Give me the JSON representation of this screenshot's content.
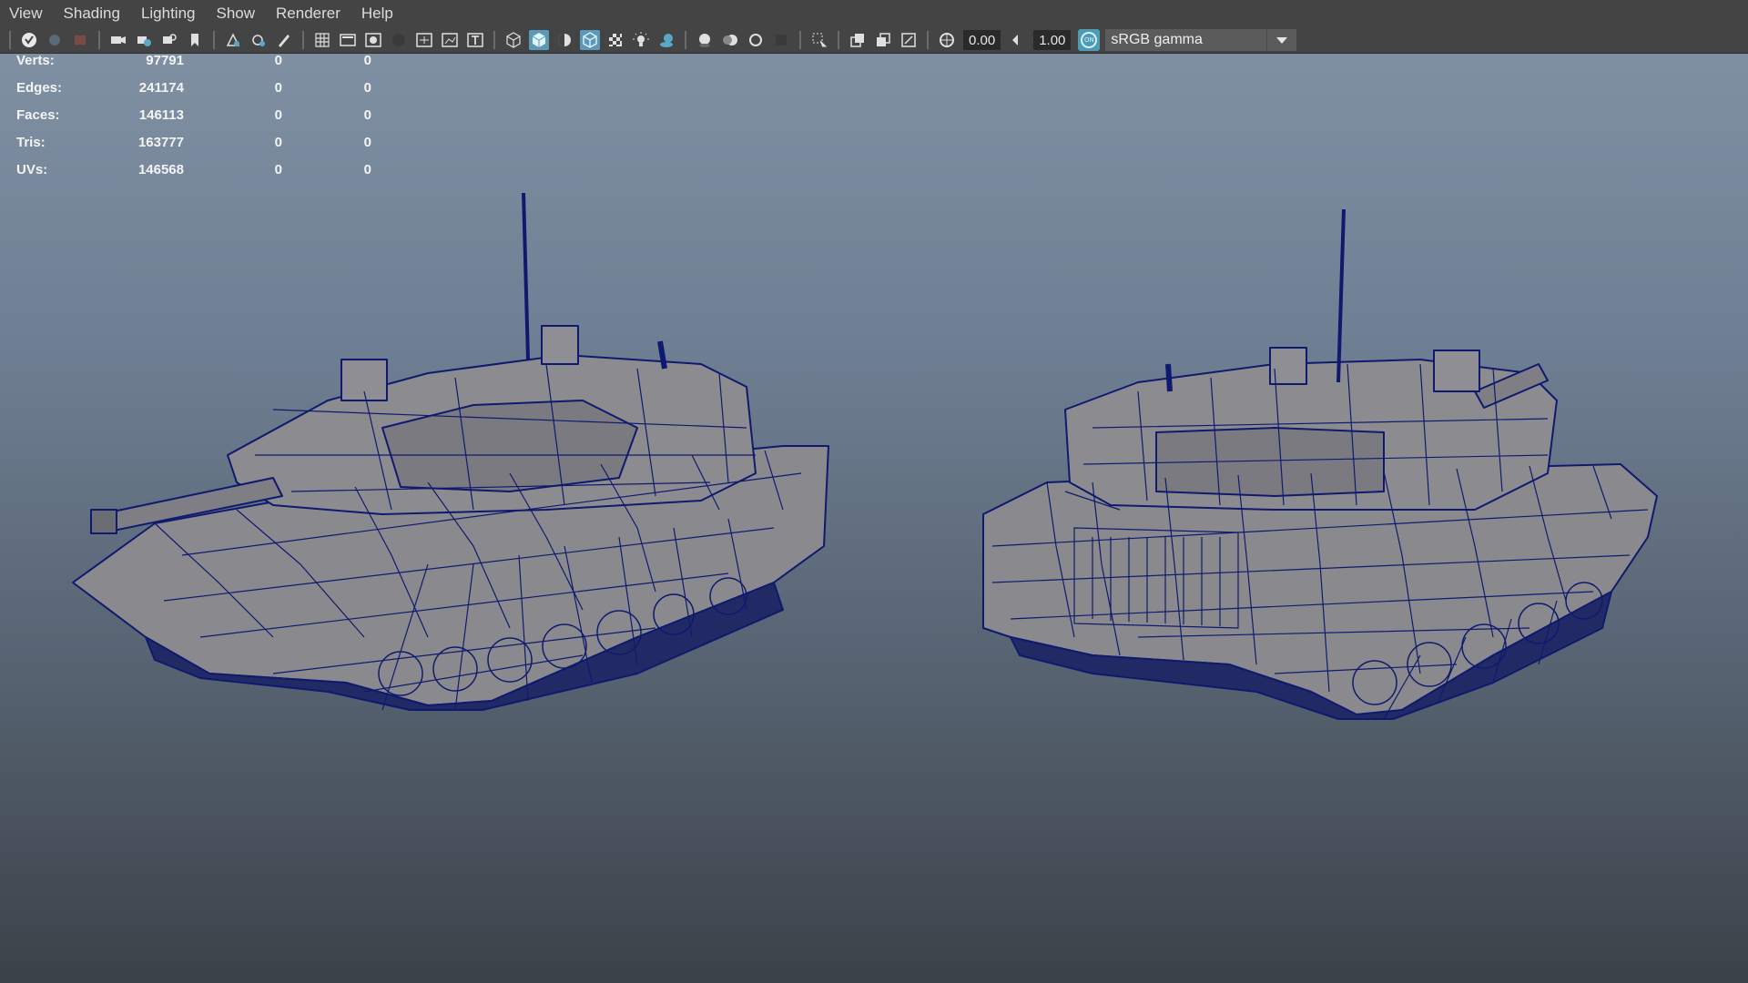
{
  "menu": [
    "View",
    "Shading",
    "Lighting",
    "Show",
    "Renderer",
    "Help"
  ],
  "toolbar": {
    "exposure": "0.00",
    "gamma": "1.00",
    "color_management_icon": "on-toggle-icon",
    "view_transform": "sRGB gamma",
    "icons": [
      "select-camera-icon",
      "camera-icon",
      "camera-attributes-icon",
      "bookmark-icon",
      "image-plane-icon",
      "grid-icon",
      "film-gate-icon",
      "resolution-gate-icon",
      "gate-mask-icon",
      "field-chart-icon",
      "safe-action-icon",
      "safe-title-icon",
      "wireframe-icon",
      "smooth-shade-icon",
      "default-material-icon",
      "wireframe-on-shaded-icon",
      "textured-icon",
      "lighting-icon",
      "shadows-icon",
      "screen-space-ao-icon",
      "motion-blur-icon",
      "anti-aliasing-icon",
      "depth-of-field-icon",
      "isolate-select-icon",
      "xray-icon",
      "xray-joints-icon",
      "backface-culling-icon",
      "exposure-icon",
      "gamma-icon"
    ]
  },
  "hud": [
    {
      "label": "Verts:",
      "v1": "97791",
      "v2": "0",
      "v3": "0"
    },
    {
      "label": "Edges:",
      "v1": "241174",
      "v2": "0",
      "v3": "0"
    },
    {
      "label": "Faces:",
      "v1": "146113",
      "v2": "0",
      "v3": "0"
    },
    {
      "label": "Tris:",
      "v1": "163777",
      "v2": "0",
      "v3": "0"
    },
    {
      "label": "UVs:",
      "v1": "146568",
      "v2": "0",
      "v3": "0"
    }
  ],
  "colors": {
    "wire": "#0f1a6e",
    "mesh_fill": "#8a8a8e",
    "accent": "#5a9ab8"
  }
}
